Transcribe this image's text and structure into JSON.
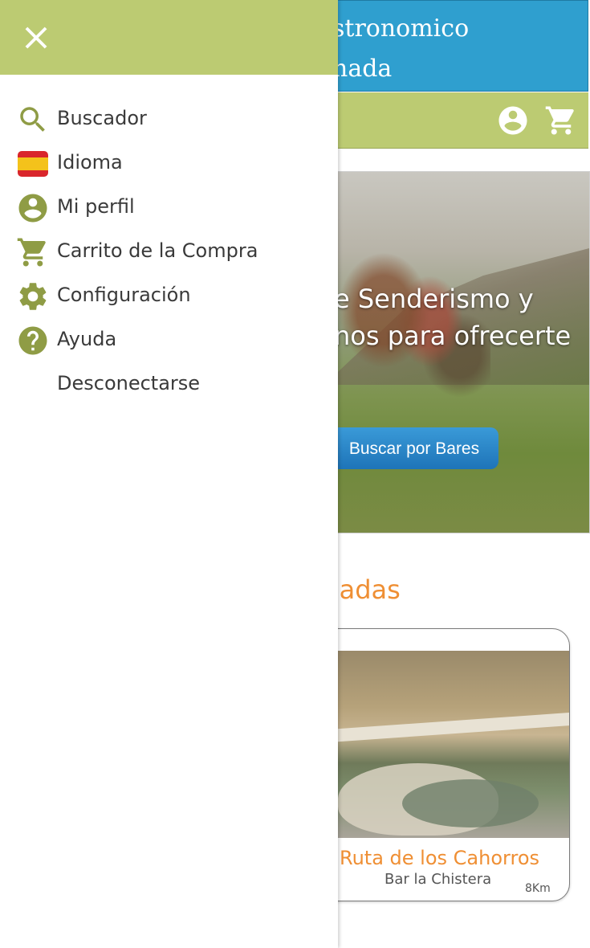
{
  "app": {
    "title_fragment_1": "stronomico",
    "title_fragment_2": "nada"
  },
  "toolbar": {
    "profile_icon": "account-circle-icon",
    "cart_icon": "shopping-cart-icon"
  },
  "hero": {
    "text_line_1": "e Senderismo y",
    "text_line_2": "nos para ofrecerte",
    "button_label": "Buscar por Bares"
  },
  "section": {
    "heading": "cadas"
  },
  "route_card": {
    "title": "Ruta de los Cahorros",
    "subtitle": "Bar la Chistera",
    "distance": "8Km"
  },
  "drawer": {
    "close_icon": "close-icon",
    "items": [
      {
        "label": "Buscador",
        "icon": "search-icon"
      },
      {
        "label": "Idioma",
        "icon": "spain-flag-icon"
      },
      {
        "label": "Mi perfil",
        "icon": "account-circle-icon"
      },
      {
        "label": "Carrito de la Compra",
        "icon": "shopping-cart-icon"
      },
      {
        "label": "Configuración",
        "icon": "gear-icon"
      },
      {
        "label": "Ayuda",
        "icon": "help-icon"
      },
      {
        "label": "Desconectarse",
        "icon": ""
      }
    ]
  },
  "colors": {
    "header_blue": "#2f9fcf",
    "toolbar_green": "#bccb72",
    "icon_olive": "#8f9c45",
    "accent_orange": "#ef8f34",
    "button_blue": "#1e74b8"
  }
}
